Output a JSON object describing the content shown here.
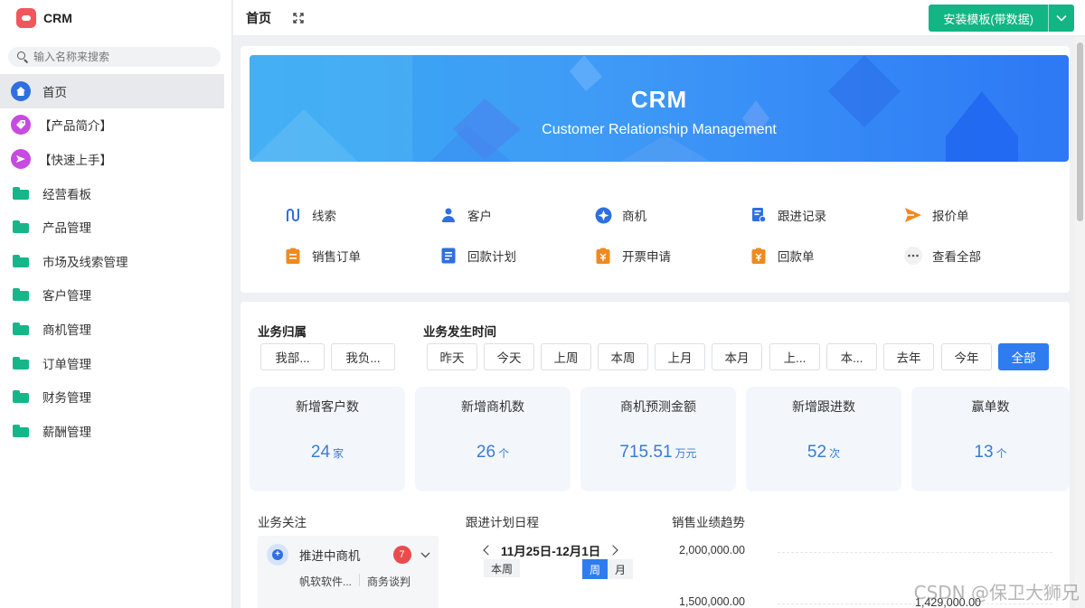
{
  "app": {
    "name": "CRM"
  },
  "sidebar": {
    "search_placeholder": "输入名称来搜索",
    "items": [
      {
        "label": "首页",
        "icon": "home-icon",
        "color": "#2f6fe0"
      },
      {
        "label": "【产品简介】",
        "icon": "tag-icon",
        "color": "#c64be0"
      },
      {
        "label": "【快速上手】",
        "icon": "send-icon",
        "color": "#c64be0"
      },
      {
        "label": "经营看板",
        "icon": "folder-icon",
        "color": "#16b68a"
      },
      {
        "label": "产品管理",
        "icon": "folder-icon",
        "color": "#16b68a"
      },
      {
        "label": "市场及线索管理",
        "icon": "folder-icon",
        "color": "#16b68a"
      },
      {
        "label": "客户管理",
        "icon": "folder-icon",
        "color": "#16b68a"
      },
      {
        "label": "商机管理",
        "icon": "folder-icon",
        "color": "#16b68a"
      },
      {
        "label": "订单管理",
        "icon": "folder-icon",
        "color": "#16b68a"
      },
      {
        "label": "财务管理",
        "icon": "folder-icon",
        "color": "#16b68a"
      },
      {
        "label": "薪酬管理",
        "icon": "folder-icon",
        "color": "#16b68a"
      }
    ]
  },
  "topbar": {
    "title": "首页",
    "install_label": "安装模板(带数据)",
    "accent": "#12b584"
  },
  "banner": {
    "title": "CRM",
    "subtitle": "Customer Relationship Management"
  },
  "quick_links": [
    {
      "label": "线索",
      "icon": "route-icon",
      "color": "#2f6fe0"
    },
    {
      "label": "客户",
      "icon": "person-icon",
      "color": "#2f6fe0"
    },
    {
      "label": "商机",
      "icon": "compass-icon",
      "color": "#2f6fe0"
    },
    {
      "label": "跟进记录",
      "icon": "record-icon",
      "color": "#2f6fe0"
    },
    {
      "label": "报价单",
      "icon": "send-icon",
      "color": "#f08a1e"
    },
    {
      "label": "销售订单",
      "icon": "clipboard-icon",
      "color": "#f08a1e"
    },
    {
      "label": "回款计划",
      "icon": "document-icon",
      "color": "#2f6fe0"
    },
    {
      "label": "开票申请",
      "icon": "invoice-icon",
      "color": "#f08a1e"
    },
    {
      "label": "回款单",
      "icon": "receipt-icon",
      "color": "#f08a1e"
    },
    {
      "label": "查看全部",
      "icon": "more-icon",
      "color": "#666666"
    }
  ],
  "filters": {
    "ownership_title": "业务归属",
    "ownership_options": [
      "我部...",
      "我负..."
    ],
    "time_title": "业务发生时间",
    "time_options": [
      "昨天",
      "今天",
      "上周",
      "本周",
      "上月",
      "本月",
      "上...",
      "本...",
      "去年",
      "今年",
      "全部"
    ],
    "time_selected": "全部"
  },
  "stats": [
    {
      "label": "新增客户数",
      "value": "24",
      "unit": "家"
    },
    {
      "label": "新增商机数",
      "value": "26",
      "unit": "个"
    },
    {
      "label": "商机预测金额",
      "value": "715.51",
      "unit": "万元"
    },
    {
      "label": "新增跟进数",
      "value": "52",
      "unit": "次"
    },
    {
      "label": "赢单数",
      "value": "13",
      "unit": "个"
    }
  ],
  "focus": {
    "title": "业务关注",
    "item_label": "推进中商机",
    "badge": "7",
    "tags": [
      "帆软软件...",
      "商务谈判"
    ]
  },
  "schedule": {
    "title": "跟进计划日程",
    "range": "11月25日-12月1日",
    "this_week": "本周",
    "view_week": "周",
    "view_month": "月",
    "view_selected": "周"
  },
  "trend": {
    "title": "销售业绩趋势",
    "y_ticks": [
      "2,000,000.00",
      "1,500,000.00"
    ],
    "visible_point_label": "1,429,000.00"
  },
  "watermark": "CSDN @保卫大狮兄"
}
